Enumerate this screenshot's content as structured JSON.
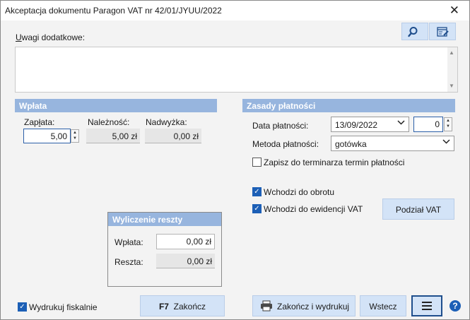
{
  "window": {
    "title": "Akceptacja dokumentu Paragon VAT nr  42/01/JYUU/2022",
    "close_glyph": "✕"
  },
  "notes": {
    "label_u": "U",
    "label_rest": "wagi dodatkowe:",
    "value": ""
  },
  "toolbar": {
    "search_icon": "search-icon",
    "edit_icon": "edit-icon"
  },
  "wplata_section": {
    "header": "Wpłata",
    "zaplata_label_pre": "Zap",
    "zaplata_label_u": "ł",
    "zaplata_label_post": "ata:",
    "zaplata_value": "5,00",
    "naleznosc_label": "Należność:",
    "naleznosc_value": "5,00 zł",
    "nadwyzka_label": "Nadwyżka:",
    "nadwyzka_value": "0,00 zł"
  },
  "payment_rules": {
    "header": "Zasady płatności",
    "date_label": "Data płatności:",
    "date_value": "13/09/2022",
    "days_value": "0",
    "method_label": "Metoda płatności:",
    "method_value": "gotówka",
    "save_term_label": "Zapisz do terminarza termin płatności",
    "save_term_checked": false
  },
  "flags": {
    "obrotu_label": "Wchodzi do obrotu",
    "obrotu_checked": true,
    "vat_label": "Wchodzi do ewidencji VAT",
    "vat_checked": true,
    "podzial_label": "Podział VAT"
  },
  "change_calc": {
    "header": "Wyliczenie reszty",
    "wplata_label": "Wpłata:",
    "wplata_value": "0,00 zł",
    "reszta_label": "Reszta:",
    "reszta_value": "0,00 zł"
  },
  "footer": {
    "fiscal_label": "Wydrukuj fiskalnie",
    "fiscal_checked": true,
    "finish_key": "F7",
    "finish_label": "Zakończ",
    "finish_print_label": "Zakończ i wydrukuj",
    "back_label": "Wstecz",
    "menu_icon": "menu-icon",
    "help_glyph": "?"
  },
  "colors": {
    "section_header": "#97b5de",
    "button_bg": "#d3e3f7",
    "checkbox_on": "#1c5fb6"
  }
}
